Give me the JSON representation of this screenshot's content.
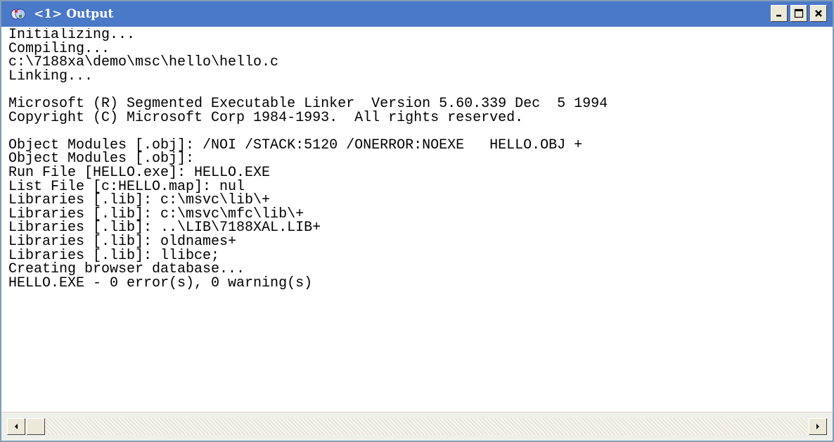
{
  "window": {
    "title": "<1> Output",
    "app_icon": "devstudio-app-icon",
    "controls": [
      "minimize-icon",
      "maximize-icon",
      "close-icon"
    ]
  },
  "output": {
    "lines": [
      "Initializing...",
      "Compiling...",
      "c:\\7188xa\\demo\\msc\\hello\\hello.c",
      "Linking...",
      "",
      "Microsoft (R) Segmented Executable Linker  Version 5.60.339 Dec  5 1994",
      "Copyright (C) Microsoft Corp 1984-1993.  All rights reserved.",
      "",
      "Object Modules [.obj]: /NOI /STACK:5120 /ONERROR:NOEXE   HELLO.OBJ +",
      "Object Modules [.obj]:",
      "Run File [HELLO.exe]: HELLO.EXE",
      "List File [c:HELLO.map]: nul",
      "Libraries [.lib]: c:\\msvc\\lib\\+",
      "Libraries [.lib]: c:\\msvc\\mfc\\lib\\+",
      "Libraries [.lib]: ..\\LIB\\7188XAL.LIB+",
      "Libraries [.lib]: oldnames+",
      "Libraries [.lib]: llibce;",
      "Creating browser database...",
      "HELLO.EXE - 0 error(s), 0 warning(s)"
    ]
  },
  "colors": {
    "titlebar": "#4a79c8",
    "text": "#000000",
    "background": "#ffffff"
  }
}
